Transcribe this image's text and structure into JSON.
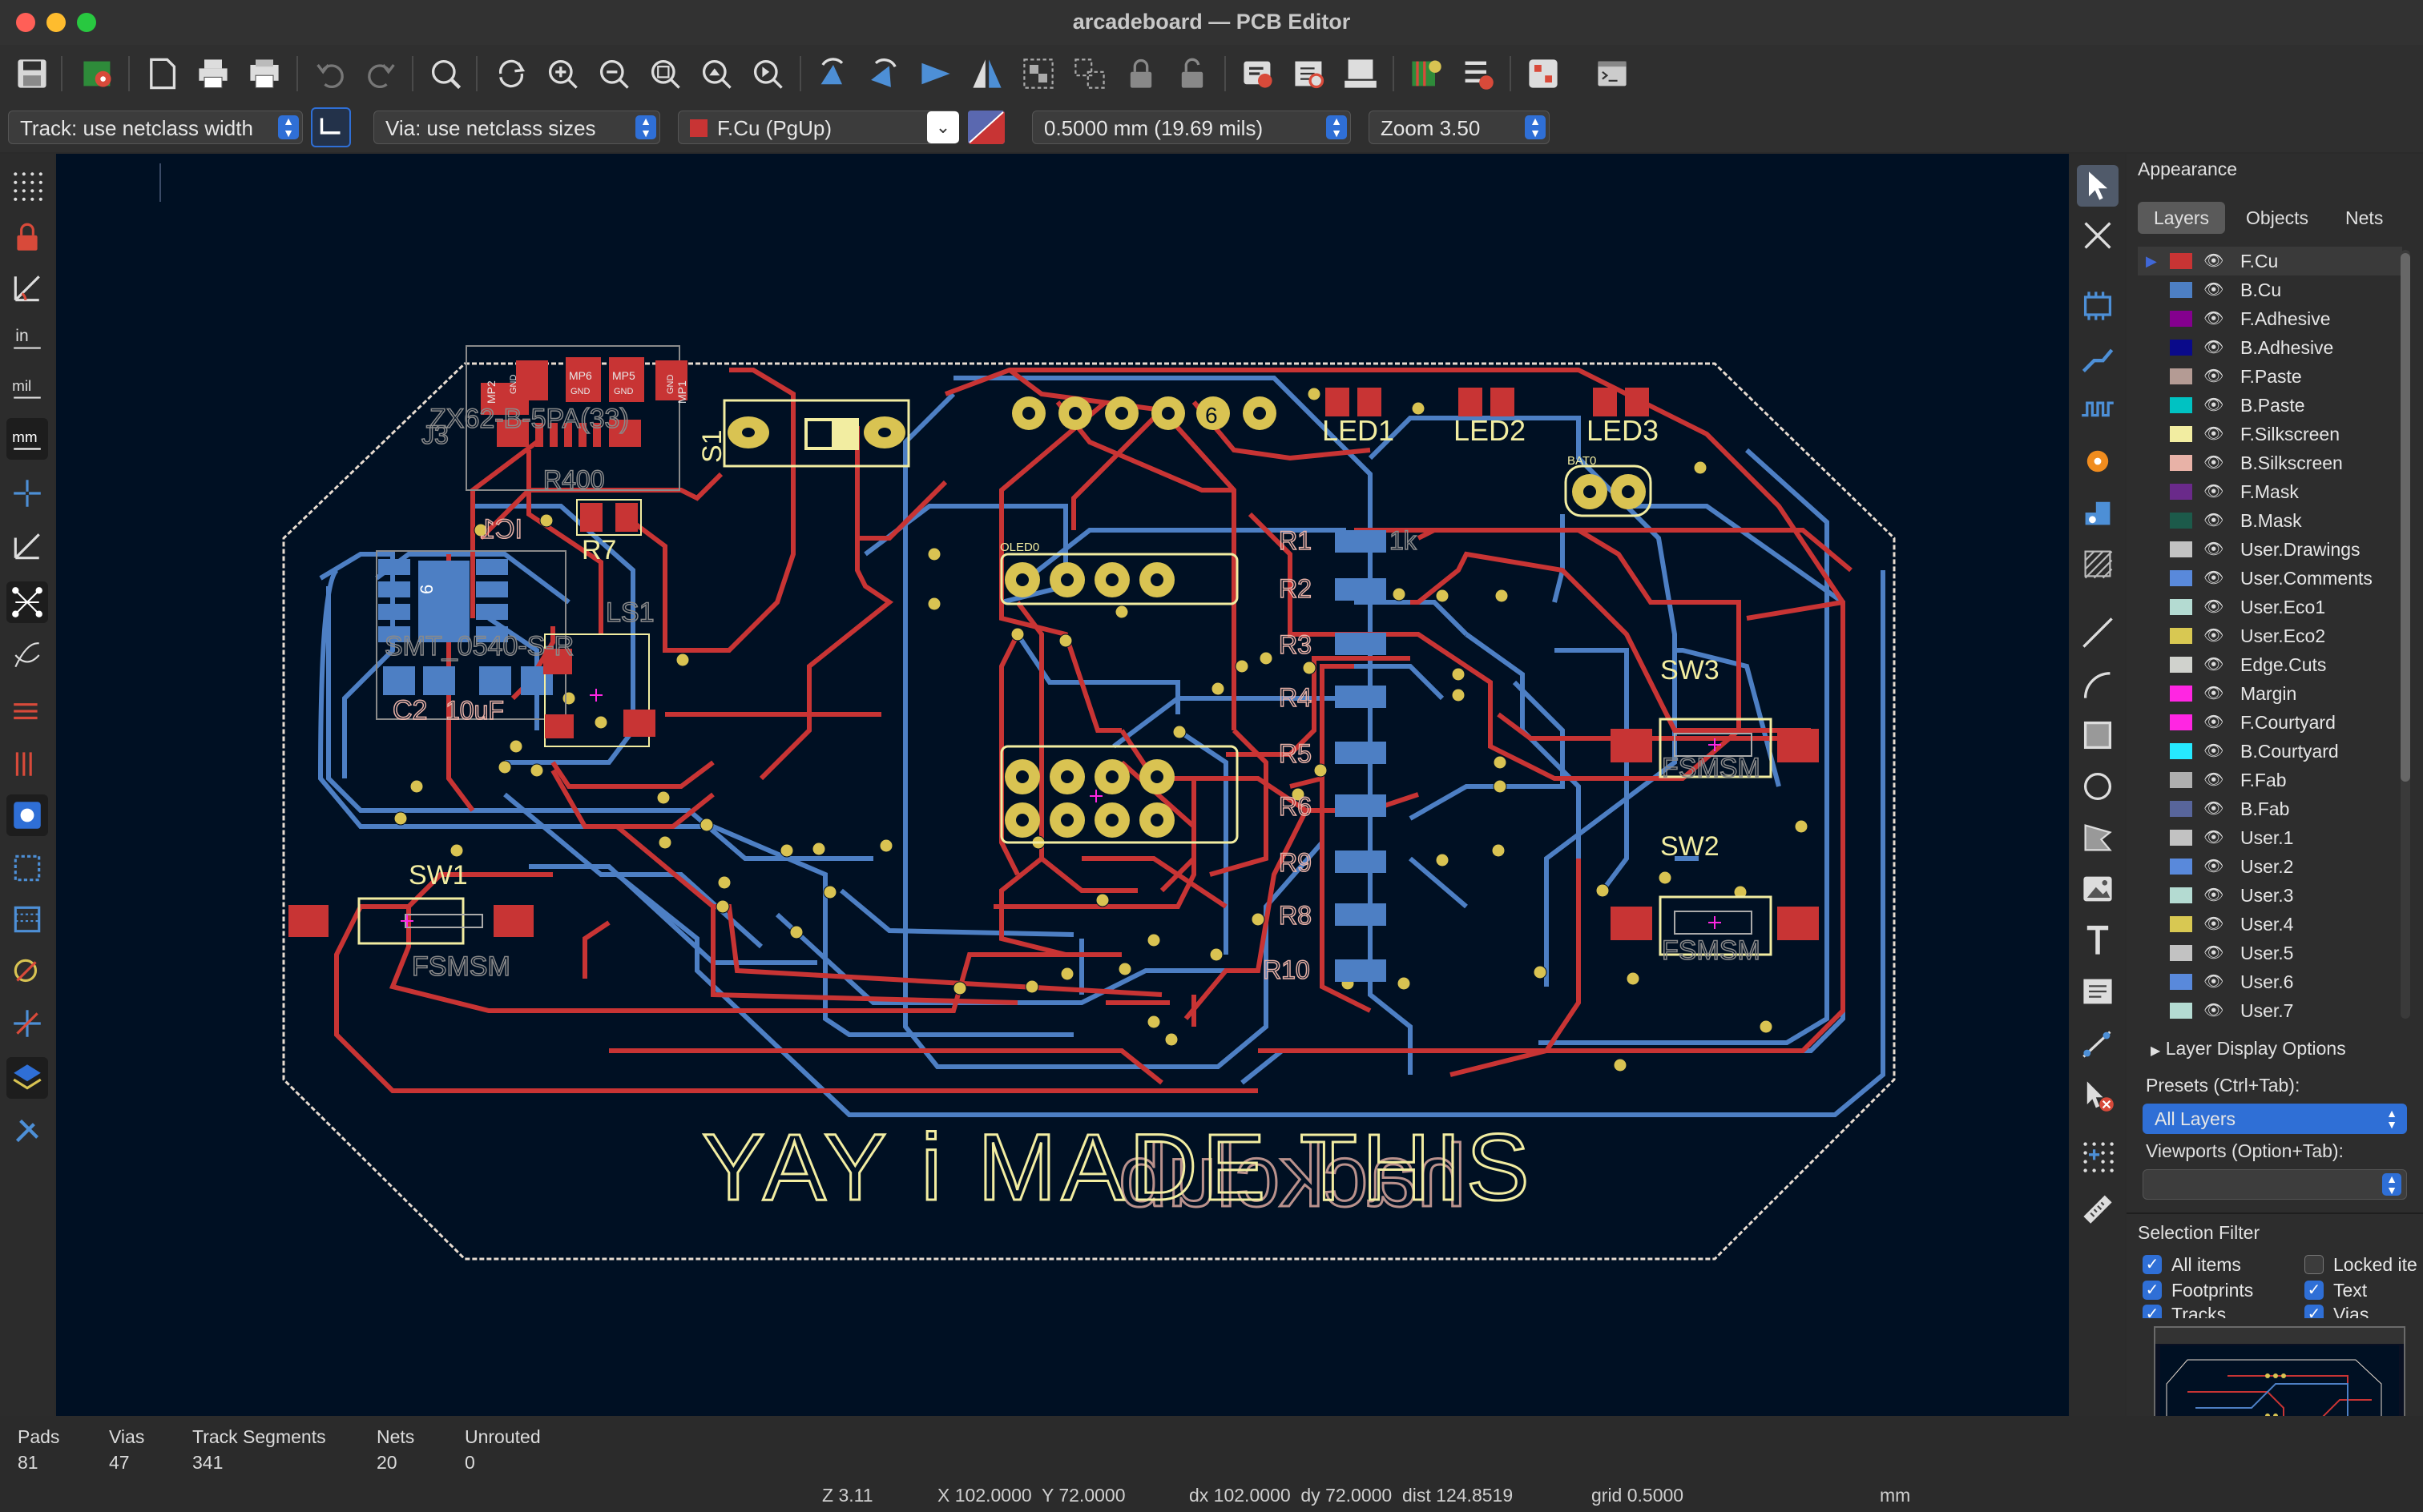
{
  "window": {
    "title": "arcadeboard — PCB Editor"
  },
  "toolbar": {
    "icons": [
      "save-icon",
      "board-setup-icon",
      "page-settings-icon",
      "print-icon",
      "plot-icon",
      "undo-icon",
      "redo-icon",
      "find-icon",
      "redraw-icon",
      "zoom-in-icon",
      "zoom-out-icon",
      "zoom-fit-icon",
      "zoom-objects-icon",
      "zoom-selection-icon",
      "rotate-ccw-icon",
      "rotate-cw-icon",
      "flip-icon",
      "mirror-icon",
      "group-icon",
      "ungroup-icon",
      "lock-icon",
      "unlock-icon",
      "netlist-update-icon",
      "footprint-editor-icon",
      "footprint-browser-icon",
      "drc-icon",
      "bom-icon",
      "scripting-icon",
      "console-icon"
    ]
  },
  "options": {
    "track": "Track: use netclass width",
    "via": "Via: use netclass sizes",
    "layer": "F.Cu (PgUp)",
    "grid": "0.5000 mm (19.69 mils)",
    "zoom": "Zoom 3.50"
  },
  "board": {
    "refs": {
      "led1": "LED1",
      "led2": "LED2",
      "led3": "LED3",
      "sw1": "SW1",
      "sw2": "SW2",
      "sw3": "SW3",
      "fsmsm": "FSMSM",
      "r400": "R400",
      "r7": "R7",
      "ic1": "IC1",
      "ls1": "LS1",
      "s1": "S1",
      "j3": "J3",
      "r1": "R1",
      "r2": "R2",
      "r3": "R3",
      "r4": "R4",
      "r5": "R5",
      "r6": "R6",
      "r9": "R9",
      "r8": "R8",
      "r10": "R10",
      "oled0": "OLED0",
      "bat0": "BAT0",
      "c2": "C2",
      "pad6": "6",
      "mp2": "MP2",
      "mp6": "MP6",
      "mp5": "MP5",
      "mp1": "MP1",
      "gnd": "GND",
      "j3_value": "ZX62-B-5PA(33)",
      "ls1_value": "SMT_0540-S-R",
      "r1_value": "1k",
      "c2_value": "10uF"
    },
    "silk_text": "YAY i MADE THIS",
    "back_text": "hackclub"
  },
  "appearance": {
    "title": "Appearance",
    "tabs": [
      "Layers",
      "Objects",
      "Nets"
    ],
    "layers": [
      {
        "name": "F.Cu",
        "color": "#c83434"
      },
      {
        "name": "B.Cu",
        "color": "#4d7fc4"
      },
      {
        "name": "F.Adhesive",
        "color": "#84008e"
      },
      {
        "name": "B.Adhesive",
        "color": "#0a0a8a"
      },
      {
        "name": "F.Paste",
        "color": "#b49b94"
      },
      {
        "name": "B.Paste",
        "color": "#00c2c2"
      },
      {
        "name": "F.Silkscreen",
        "color": "#f2eda1"
      },
      {
        "name": "B.Silkscreen",
        "color": "#e8b2a7"
      },
      {
        "name": "F.Mask",
        "color": "#6a2a8a"
      },
      {
        "name": "B.Mask",
        "color": "#1c5a4a"
      },
      {
        "name": "User.Drawings",
        "color": "#c2c2c2"
      },
      {
        "name": "User.Comments",
        "color": "#5989db"
      },
      {
        "name": "User.Eco1",
        "color": "#b4dbd2"
      },
      {
        "name": "User.Eco2",
        "color": "#d8c852"
      },
      {
        "name": "Edge.Cuts",
        "color": "#d0d2cd"
      },
      {
        "name": "Margin",
        "color": "#ff26e2"
      },
      {
        "name": "F.Courtyard",
        "color": "#ff26e2"
      },
      {
        "name": "B.Courtyard",
        "color": "#26e9ff"
      },
      {
        "name": "F.Fab",
        "color": "#afafaf"
      },
      {
        "name": "B.Fab",
        "color": "#58659b"
      },
      {
        "name": "User.1",
        "color": "#c2c2c2"
      },
      {
        "name": "User.2",
        "color": "#5989db"
      },
      {
        "name": "User.3",
        "color": "#b4dbd2"
      },
      {
        "name": "User.4",
        "color": "#d8c852"
      },
      {
        "name": "User.5",
        "color": "#c2c2c2"
      },
      {
        "name": "User.6",
        "color": "#5989db"
      },
      {
        "name": "User.7",
        "color": "#b4dbd2"
      }
    ],
    "layer_display_options": "Layer Display Options",
    "presets_label": "Presets (Ctrl+Tab):",
    "presets_value": "All Layers",
    "viewports_label": "Viewports (Option+Tab):",
    "viewports_value": "",
    "selection_filter_title": "Selection Filter",
    "filters": [
      {
        "label": "All items",
        "checked": true
      },
      {
        "label": "Locked ite",
        "checked": false
      },
      {
        "label": "Footprints",
        "checked": true
      },
      {
        "label": "Text",
        "checked": true
      },
      {
        "label": "Tracks",
        "checked": true
      },
      {
        "label": "Vias",
        "checked": true
      }
    ]
  },
  "messages": {
    "pads_label": "Pads",
    "pads": "81",
    "vias_label": "Vias",
    "vias": "47",
    "tracks_label": "Track Segments",
    "tracks": "341",
    "nets_label": "Nets",
    "nets": "20",
    "unrouted_label": "Unrouted",
    "unrouted": "0"
  },
  "status": {
    "zoom": "Z 3.11",
    "xy": "X 102.0000  Y 72.0000",
    "dxy": "dx 102.0000  dy 72.0000  dist 124.8519",
    "grid": "grid 0.5000",
    "units": "mm"
  },
  "colors": {
    "fcu": "#c83434",
    "bcu": "#4d7fc4",
    "silk": "#f2eda1",
    "bsilk": "#e8b2a7",
    "edge": "#e8dcd0",
    "via": "#d9c352",
    "bg": "#001023",
    "accent": "#2f6fd6"
  }
}
